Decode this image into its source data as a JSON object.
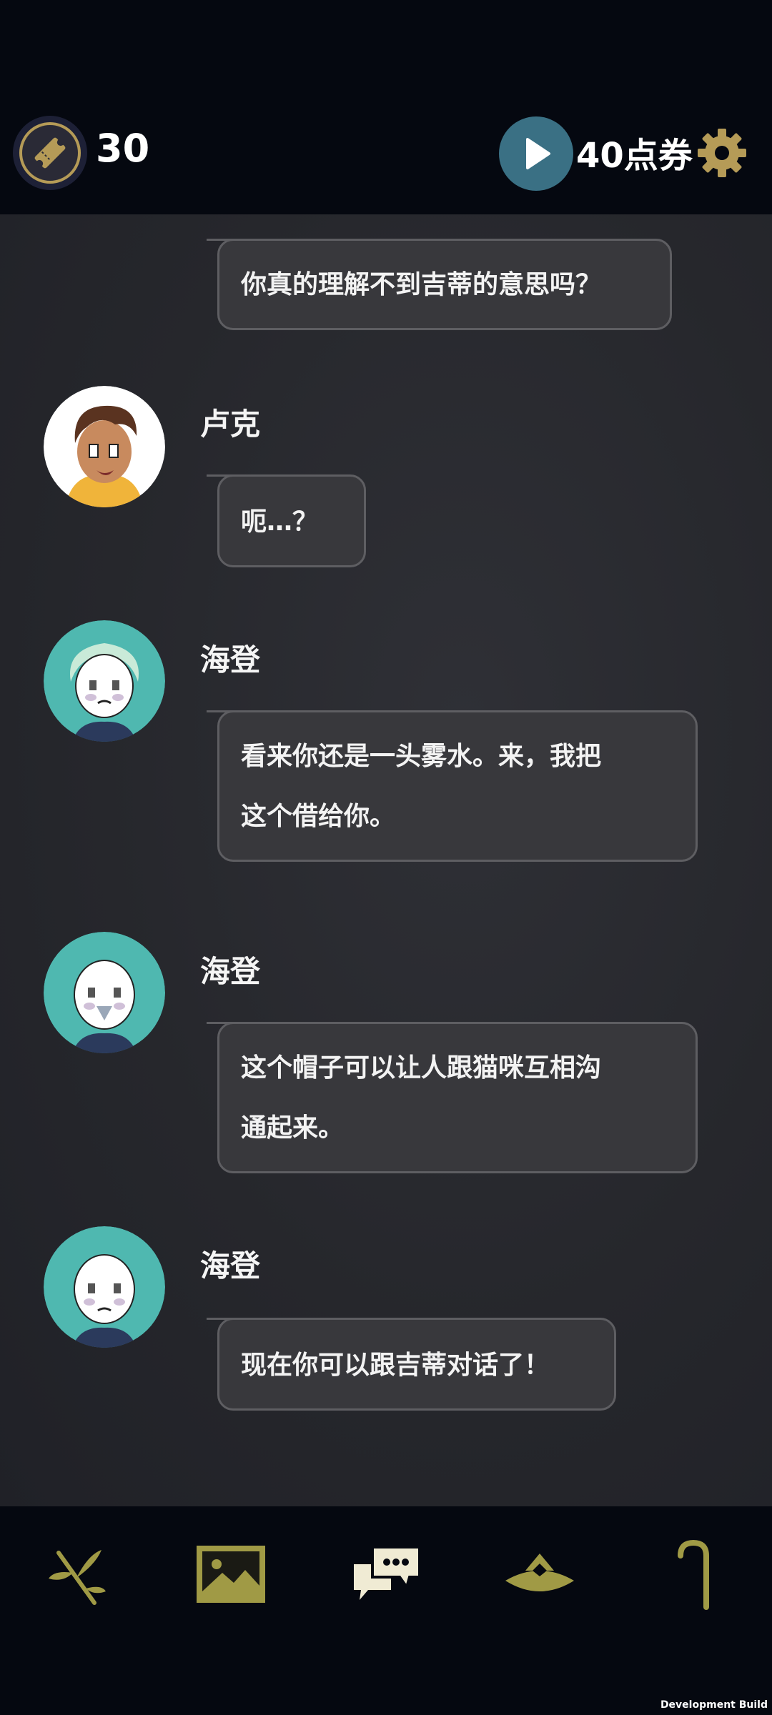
{
  "header": {
    "ticket_count": "30",
    "coupon_label": "40点券"
  },
  "messages": [
    {
      "speaker": "",
      "text_lines": [
        "你真的理解不到吉蒂的意思吗？"
      ]
    },
    {
      "speaker": "卢克",
      "text_lines": [
        "呃…？"
      ]
    },
    {
      "speaker": "海登",
      "text_lines": [
        "看来你还是一头雾水。来，我把",
        "这个借给你。"
      ]
    },
    {
      "speaker": "海登",
      "text_lines": [
        "这个帽子可以让人跟猫咪互相沟",
        "通起来。"
      ]
    },
    {
      "speaker": "海登",
      "text_lines": [
        "现在你可以跟吉蒂对话了！"
      ]
    }
  ],
  "nav": {
    "items": [
      "branch-icon",
      "gallery-icon",
      "chat-icon",
      "hat-icon",
      "cane-icon"
    ]
  },
  "footer": {
    "build_label": "Development Build"
  },
  "colors": {
    "gold": "#a09a45",
    "bubble": "#38383c",
    "avatar_teal": "#4fb8b0",
    "bg_dark": "#050810"
  }
}
